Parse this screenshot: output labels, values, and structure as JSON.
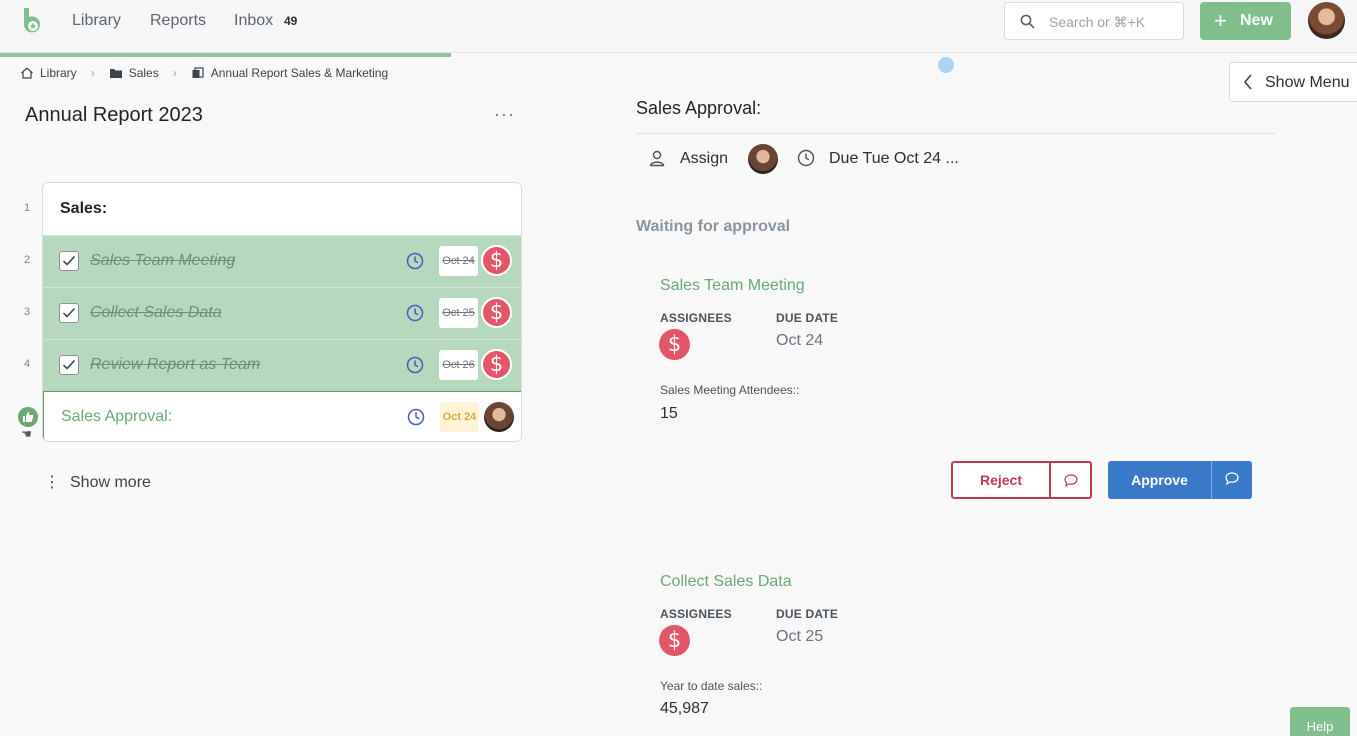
{
  "nav": {
    "library": "Library",
    "reports": "Reports",
    "inbox": "Inbox",
    "inbox_count": "49",
    "search_placeholder": "Search or ⌘+K",
    "new_label": "New"
  },
  "breadcrumb": {
    "library": "Library",
    "folder": "Sales",
    "doc": "Annual Report Sales & Marketing"
  },
  "document": {
    "title": "Annual Report 2023",
    "more": "···",
    "line_numbers": [
      "1",
      "2",
      "3",
      "4"
    ],
    "list_header": "Sales:",
    "tasks": [
      {
        "label": "Sales Team Meeting",
        "date": "Oct 24",
        "assignee_icon": "$"
      },
      {
        "label": "Collect Sales Data",
        "date": "Oct 25",
        "assignee_icon": "$"
      },
      {
        "label": "Review Report as Team",
        "date": "Oct 26",
        "assignee_icon": "$"
      }
    ],
    "approval": {
      "label": "Sales Approval:",
      "date": "Oct 24"
    },
    "show_more": "Show more"
  },
  "panel": {
    "show_menu": "Show Menu",
    "title": "Sales Approval:",
    "assign": "Assign",
    "due": "Due Tue Oct 24 ...",
    "waiting": "Waiting for approval",
    "cards": [
      {
        "title": "Sales Team Meeting",
        "assignees_label": "ASSIGNEES",
        "due_label": "DUE DATE",
        "due": "Oct 24",
        "field_label": "Sales Meeting Attendees::",
        "field_value": "15"
      },
      {
        "title": "Collect Sales Data",
        "assignees_label": "ASSIGNEES",
        "due_label": "DUE DATE",
        "due": "Oct 25",
        "field_label": "Year to date sales::",
        "field_value": "45,987"
      }
    ],
    "reject": "Reject",
    "approve": "Approve",
    "help": "Help"
  },
  "colors": {
    "brand_green": "#7fbf8c",
    "done_row": "#b6d9bd",
    "reject_red": "#c23a4f",
    "approve_blue": "#3a78c8",
    "assignee_red": "#e3566a"
  },
  "icons": [
    "logo-icon",
    "search-icon",
    "plus-icon",
    "home-icon",
    "folder-icon",
    "document-icon",
    "chevron-right-icon",
    "check-icon",
    "clock-icon",
    "dollar-icon",
    "thumbs-up-icon",
    "hand-cursor-icon",
    "kebab-icon",
    "chevron-left-icon",
    "person-icon",
    "comment-icon"
  ]
}
